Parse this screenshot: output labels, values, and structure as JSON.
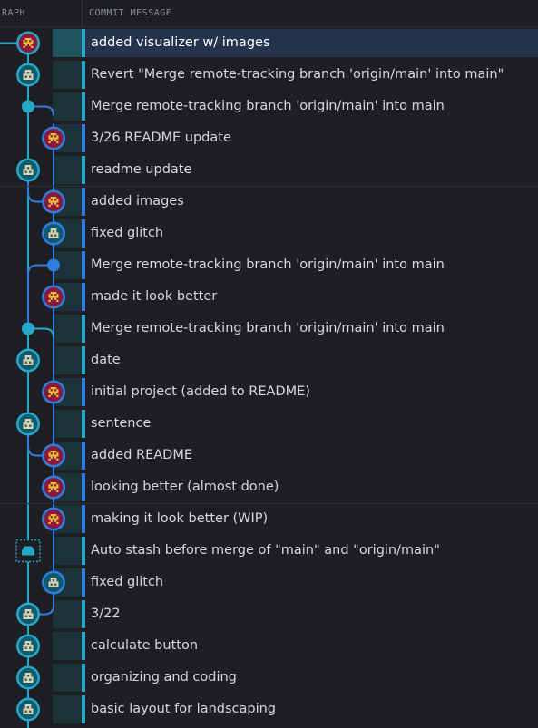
{
  "header": {
    "graph_label": "RAPH",
    "message_label": "COMMIT MESSAGE"
  },
  "colors": {
    "background": "#1e1f24",
    "lane_main": "#2f7de0",
    "lane_teal": "#27a8c8",
    "selected_row": "#26334d",
    "text": "#d6d8dc"
  },
  "commits": [
    {
      "message": "added visualizer w/ images",
      "lane": 1,
      "type": "avatar-b",
      "selected": true
    },
    {
      "message": "Revert \"Merge remote-tracking branch 'origin/main' into main\"",
      "lane": 1,
      "type": "avatar-a"
    },
    {
      "message": "Merge remote-tracking branch 'origin/main' into main",
      "lane": 1,
      "type": "merge-teal"
    },
    {
      "message": "3/26 README update",
      "lane": 2,
      "type": "avatar-b"
    },
    {
      "message": "readme update",
      "lane": 1,
      "type": "avatar-a"
    },
    {
      "message": "added images",
      "lane": 2,
      "type": "avatar-b"
    },
    {
      "message": "fixed glitch",
      "lane": 2,
      "type": "avatar-a"
    },
    {
      "message": "Merge remote-tracking branch 'origin/main' into main",
      "lane": 2,
      "type": "merge-blue"
    },
    {
      "message": "made it look better",
      "lane": 2,
      "type": "avatar-b"
    },
    {
      "message": "Merge remote-tracking branch 'origin/main' into main",
      "lane": 1,
      "type": "merge-teal"
    },
    {
      "message": "date",
      "lane": 1,
      "type": "avatar-a"
    },
    {
      "message": "initial project (added to README)",
      "lane": 2,
      "type": "avatar-b"
    },
    {
      "message": "sentence",
      "lane": 1,
      "type": "avatar-a"
    },
    {
      "message": "added README",
      "lane": 2,
      "type": "avatar-b"
    },
    {
      "message": "looking better (almost done)",
      "lane": 2,
      "type": "avatar-b"
    },
    {
      "message": "making it look better (WIP)",
      "lane": 2,
      "type": "avatar-b"
    },
    {
      "message": "Auto stash before merge of \"main\" and \"origin/main\"",
      "lane": 1,
      "type": "stash"
    },
    {
      "message": "fixed glitch",
      "lane": 2,
      "type": "avatar-a"
    },
    {
      "message": "3/22",
      "lane": 1,
      "type": "avatar-a"
    },
    {
      "message": "calculate button",
      "lane": 1,
      "type": "avatar-a"
    },
    {
      "message": "organizing and coding",
      "lane": 1,
      "type": "avatar-a"
    },
    {
      "message": "basic layout for landscaping",
      "lane": 1,
      "type": "avatar-a"
    }
  ]
}
